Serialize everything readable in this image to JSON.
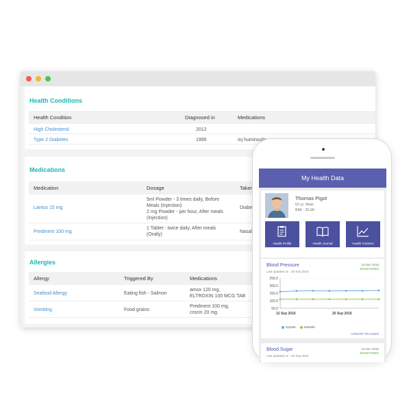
{
  "health_conditions": {
    "title": "Health Conditions",
    "headers": [
      "Health Condition",
      "Diagnosed in",
      "Medications"
    ],
    "rows": [
      {
        "condition": "High Cholesterol",
        "diagnosed": "2012",
        "medications": ""
      },
      {
        "condition": "Type 2 Diabetes",
        "diagnosed": "1995",
        "medications": "inj huminsulin"
      }
    ]
  },
  "medications": {
    "title": "Medications",
    "headers": [
      "Medication",
      "Dosage",
      "Taken"
    ],
    "rows": [
      {
        "medication": "Lantus 15 mg",
        "dosage": [
          "5ml Powder - 3 times daily, Before",
          "Meals (Injection)",
          "2 mg Powder - per hour, After meals",
          "(Injection)"
        ],
        "taken": "Diabet"
      },
      {
        "medication": "Predment 100 mg",
        "dosage": [
          "1 Tablet - twice daily, After meals",
          "(Orally)"
        ],
        "taken": "Nasal I"
      }
    ]
  },
  "allergies": {
    "title": "Allergies",
    "headers": [
      "Allergy",
      "Triggered By",
      "Medications"
    ],
    "rows": [
      {
        "allergy": "Seafood Allergy",
        "trigger": "Eating fish - Salmon",
        "medications": [
          "amox 120 mg,",
          "ELTROXIN 100 MCG TAB"
        ]
      },
      {
        "allergy": "Vomiting",
        "trigger": "Food grains",
        "medications": [
          "Predment 100 mg,",
          "crocin 20 mg"
        ]
      }
    ]
  },
  "app": {
    "title": "My Health Data",
    "profile": {
      "name": "Thomas Pigot",
      "age": "62 yr, Male",
      "bmi": "BMI : 26.96"
    },
    "tiles": [
      {
        "label": "Health Profile",
        "icon": "clipboard-icon"
      },
      {
        "label": "Health Journal",
        "icon": "open-book-icon"
      },
      {
        "label": "Health Trackers",
        "icon": "trend-chart-icon"
      }
    ],
    "blood_pressure": {
      "title": "Blood Pressure",
      "date": "16 Dec 2016",
      "updated": "Last updated on : 30 Sep 2016",
      "status": "MONITORED",
      "link": "UPDATE TRACKER"
    },
    "blood_sugar": {
      "title": "Blood Sugar",
      "date": "16 Dec 2016",
      "updated": "Last updated on : 05 Sep 2016",
      "status": "MONITORED"
    }
  },
  "chart_data": {
    "type": "line",
    "y_ticks": [
      "250.0",
      "200.0",
      "150.0",
      "100.0",
      "50.0"
    ],
    "ylim": [
      50,
      250
    ],
    "x_ticks": [
      "12 Sep 2016",
      "25 Sep 2016"
    ],
    "series": [
      {
        "name": "Systolic",
        "color": "#6aaed6",
        "values": [
          160,
          165,
          166,
          165,
          166,
          166,
          168
        ]
      },
      {
        "name": "Diastolic",
        "color": "#8fc95b",
        "values": [
          110,
          110,
          110,
          110,
          110,
          110,
          110
        ]
      }
    ]
  }
}
